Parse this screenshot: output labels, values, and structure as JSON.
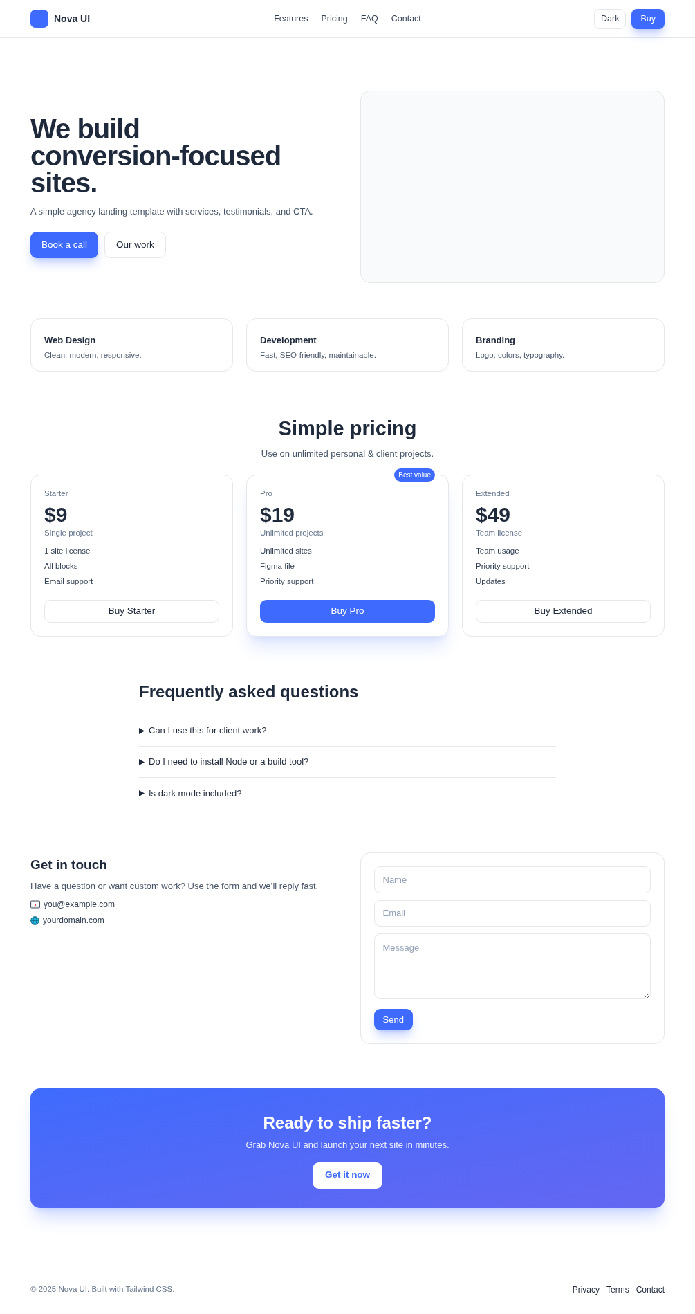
{
  "header": {
    "brand": "Nova UI",
    "nav": [
      "Features",
      "Pricing",
      "FAQ",
      "Contact"
    ],
    "theme_button": "Dark",
    "buy_button": "Buy"
  },
  "hero": {
    "title": "We build conversion-focused sites.",
    "subtitle": "A simple agency landing template with services, testimonials, and CTA.",
    "primary_button": "Book a call",
    "secondary_button": "Our work",
    "media": {
      "kind": "placeholder"
    }
  },
  "services": [
    {
      "title": "Web Design",
      "description": "Clean, modern, responsive."
    },
    {
      "title": "Development",
      "description": "Fast, SEO-friendly, maintainable."
    },
    {
      "title": "Branding",
      "description": "Logo, colors, typography."
    }
  ],
  "pricing": {
    "title": "Simple pricing",
    "subtitle": "Use on unlimited personal & client projects.",
    "plans": [
      {
        "name": "Starter",
        "price": "$9",
        "note": "Single project",
        "features": [
          "1 site license",
          "All blocks",
          "Email support"
        ],
        "button": "Buy Starter",
        "featured": false
      },
      {
        "name": "Pro",
        "price": "$19",
        "note": "Unlimited projects",
        "features": [
          "Unlimited sites",
          "Figma file",
          "Priority support"
        ],
        "button": "Buy Pro",
        "featured": true,
        "badge": "Best value"
      },
      {
        "name": "Extended",
        "price": "$49",
        "note": "Team license",
        "features": [
          "Team usage",
          "Priority support",
          "Updates"
        ],
        "button": "Buy Extended",
        "featured": false
      }
    ]
  },
  "faq": {
    "title": "Frequently asked questions",
    "items": [
      {
        "question": "Can I use this for client work?",
        "expanded": false
      },
      {
        "question": "Do I need to install Node or a build tool?",
        "expanded": false
      },
      {
        "question": "Is dark mode included?",
        "expanded": false
      }
    ]
  },
  "contact": {
    "title": "Get in touch",
    "text": "Have a question or want custom work? Use the form and we’ll reply fast.",
    "links": [
      {
        "kind": "email",
        "text": "you@example.com"
      },
      {
        "kind": "web",
        "text": "yourdomain.com"
      }
    ],
    "form": {
      "name_placeholder": "Name",
      "email_placeholder": "Email",
      "message_placeholder": "Message",
      "submit": "Send"
    }
  },
  "cta": {
    "title": "Ready to ship faster?",
    "text": "Grab Nova UI and launch your next site in minutes.",
    "button": "Get it now"
  },
  "footer": {
    "copyright": "© 2025 Nova UI. Built with Tailwind CSS.",
    "links": [
      "Privacy",
      "Terms",
      "Contact"
    ]
  }
}
